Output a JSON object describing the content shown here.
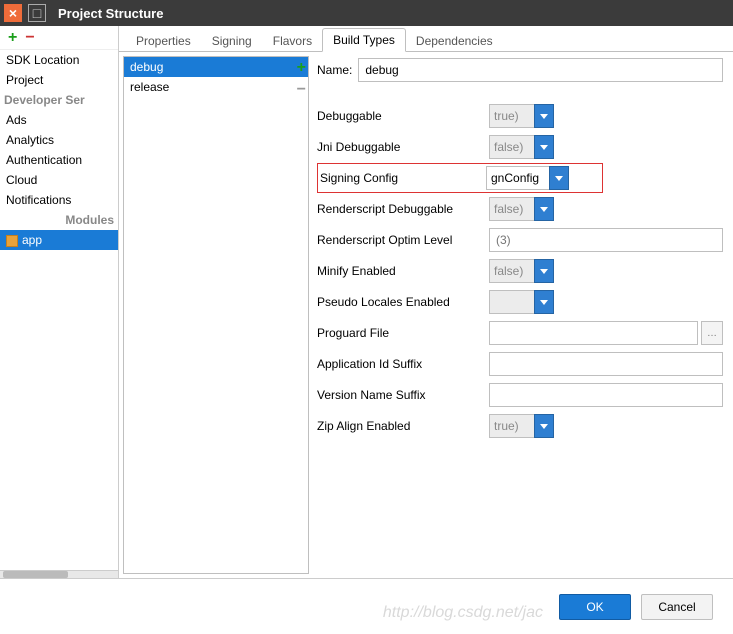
{
  "window": {
    "title": "Project Structure"
  },
  "sidebar": {
    "items": [
      {
        "label": "SDK Location"
      },
      {
        "label": "Project"
      },
      {
        "label": "Developer Ser",
        "group": true
      },
      {
        "label": "Ads"
      },
      {
        "label": "Analytics"
      },
      {
        "label": "Authentication"
      },
      {
        "label": "Cloud"
      },
      {
        "label": "Notifications"
      },
      {
        "label": "Modules",
        "group": true
      },
      {
        "label": "app",
        "selected": true,
        "icon": true
      }
    ]
  },
  "tabs": [
    {
      "label": "Properties"
    },
    {
      "label": "Signing"
    },
    {
      "label": "Flavors"
    },
    {
      "label": "Build Types",
      "active": true
    },
    {
      "label": "Dependencies"
    }
  ],
  "buildTypes": {
    "items": [
      {
        "label": "debug",
        "selected": true
      },
      {
        "label": "release"
      }
    ]
  },
  "form": {
    "nameLabel": "Name:",
    "nameValue": "debug",
    "rows": {
      "debuggable": {
        "label": "Debuggable",
        "value": "true)",
        "disabled": true
      },
      "jniDebuggable": {
        "label": "Jni Debuggable",
        "value": "false)",
        "disabled": true
      },
      "signingConfig": {
        "label": "Signing Config",
        "value": "gnConfig",
        "wide": true
      },
      "rsDebuggable": {
        "label": "Renderscript Debuggable",
        "value": "false)",
        "disabled": true
      },
      "rsOptim": {
        "label": "Renderscript Optim Level",
        "placeholder": "(3)"
      },
      "minify": {
        "label": "Minify Enabled",
        "value": "false)",
        "disabled": true
      },
      "pseudoLocales": {
        "label": "Pseudo Locales Enabled",
        "value": "",
        "disabled": true
      },
      "proguard": {
        "label": "Proguard File",
        "value": ""
      },
      "appIdSuffix": {
        "label": "Application Id Suffix",
        "value": ""
      },
      "versionSuffix": {
        "label": "Version Name Suffix",
        "value": ""
      },
      "zipAlign": {
        "label": "Zip Align Enabled",
        "value": "true)",
        "disabled": true
      }
    }
  },
  "footer": {
    "ok": "OK",
    "cancel": "Cancel",
    "watermark": "http://blog.csdg.net/jac"
  }
}
